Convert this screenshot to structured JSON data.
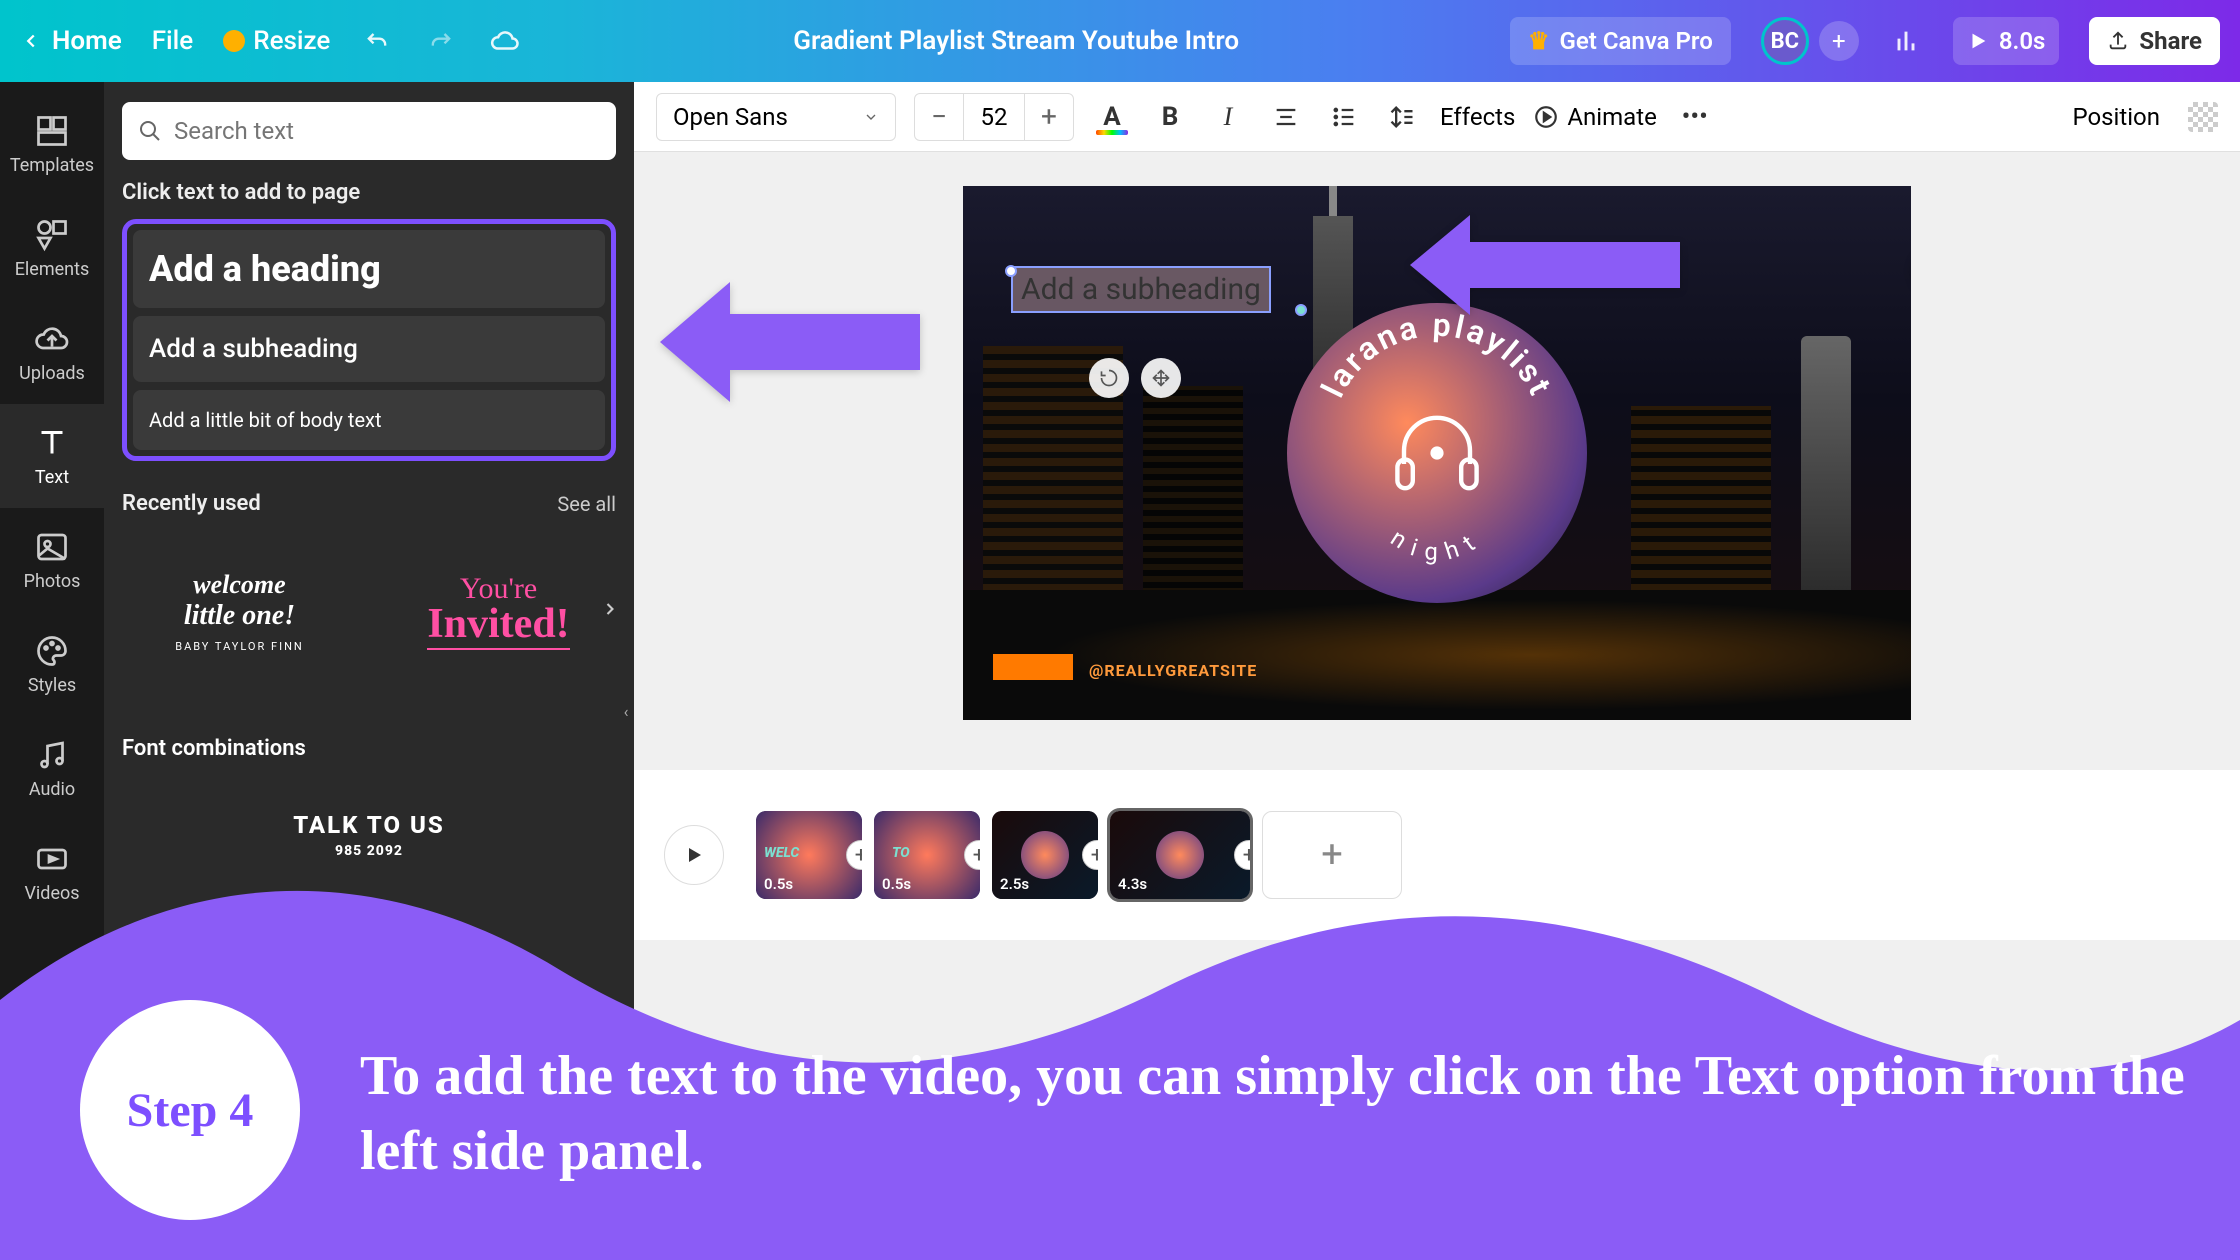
{
  "topbar": {
    "home": "Home",
    "file": "File",
    "resize": "Resize",
    "title": "Gradient Playlist Stream Youtube Intro",
    "getPro": "Get Canva Pro",
    "avatar": "BC",
    "duration": "8.0s",
    "share": "Share"
  },
  "leftrail": {
    "templates": "Templates",
    "elements": "Elements",
    "uploads": "Uploads",
    "text": "Text",
    "photos": "Photos",
    "styles": "Styles",
    "audio": "Audio",
    "videos": "Videos"
  },
  "sidepanel": {
    "searchPlaceholder": "Search text",
    "clickToAdd": "Click text to add to page",
    "heading": "Add a heading",
    "subheading": "Add a subheading",
    "body": "Add a little bit of body text",
    "recentlyUsed": "Recently used",
    "seeAll": "See all",
    "recent1_l1": "welcome",
    "recent1_l2": "little one!",
    "recent1_l3": "BABY TAYLOR FINN",
    "recent2_l1": "You're",
    "recent2_l2": "Invited!",
    "fontCombos": "Font combinations",
    "talkToUs": "TALK TO US",
    "talkSmall": "985 2092"
  },
  "toolbar": {
    "font": "Open Sans",
    "size": "52",
    "effects": "Effects",
    "animate": "Animate",
    "position": "Position"
  },
  "canvas": {
    "subheadingText": "Add a subheading",
    "siteUrl": "@REALLYGREATSITE",
    "logoTop": "larana playlist",
    "logoBottom": "night"
  },
  "timeline": {
    "clips": [
      {
        "dur": "0.5s",
        "label": "WELC"
      },
      {
        "dur": "0.5s",
        "label": "TO"
      },
      {
        "dur": "2.5s",
        "label": ""
      },
      {
        "dur": "4.3s",
        "label": ""
      }
    ]
  },
  "overlay": {
    "step": "Step 4",
    "text": "To add the text to the video, you can simply click on the Text option from the left side panel."
  }
}
